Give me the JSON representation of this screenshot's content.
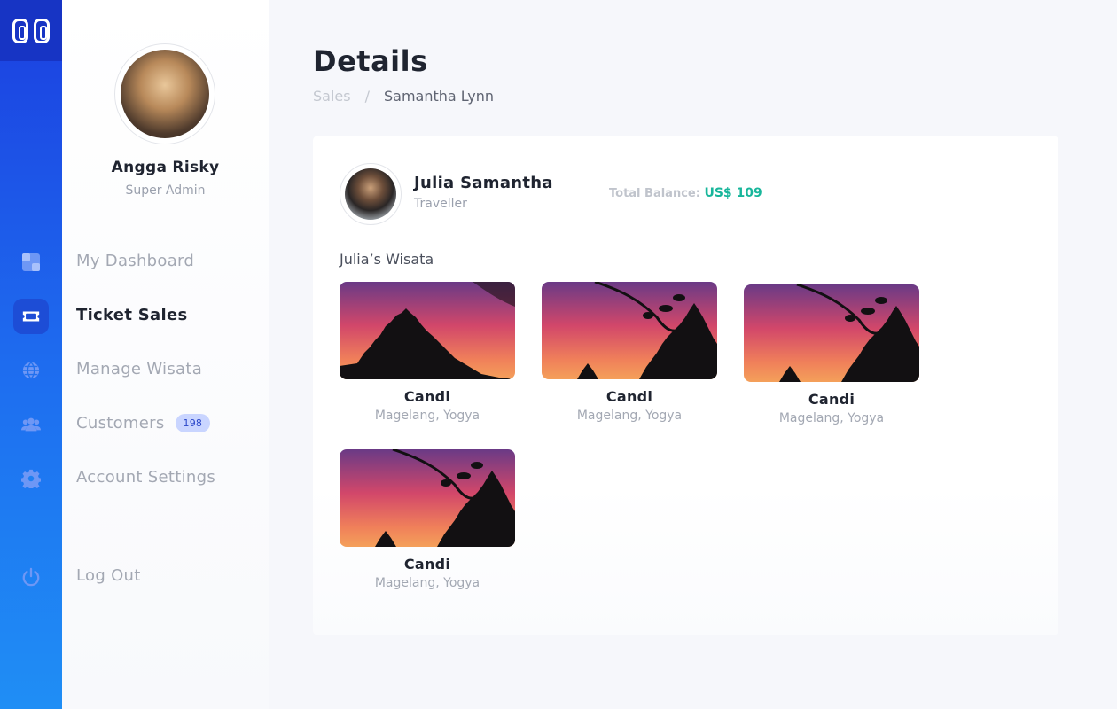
{
  "rail": {
    "icons": [
      "logo-icon",
      "dashboard-icon",
      "ticket-icon",
      "globe-icon",
      "users-icon",
      "gear-icon",
      "power-icon"
    ],
    "accent": "#1c3fe0"
  },
  "profile": {
    "name": "Angga Risky",
    "role": "Super Admin"
  },
  "menu": {
    "dashboard": "My Dashboard",
    "ticket_sales": "Ticket Sales",
    "manage_wisata": "Manage Wisata",
    "customers": "Customers",
    "customers_count": "198",
    "account_settings": "Account Settings",
    "logout": "Log Out"
  },
  "page": {
    "title": "Details",
    "breadcrumb": {
      "parent": "Sales",
      "separator": "/",
      "current": "Samantha Lynn"
    }
  },
  "customer": {
    "name": "Julia Samantha",
    "role": "Traveller",
    "balance_label": "Total Balance:",
    "balance_value": "US$ 109"
  },
  "wisata_section": {
    "title": "Julia’s Wisata",
    "items": [
      {
        "name": "Candi",
        "location": "Magelang, Yogya"
      },
      {
        "name": "Candi",
        "location": "Magelang, Yogya"
      },
      {
        "name": "Candi",
        "location": "Magelang, Yogya"
      },
      {
        "name": "Candi",
        "location": "Magelang, Yogya"
      }
    ]
  },
  "colors": {
    "balance": "#18b69b",
    "badge_bg": "#c9d5ff",
    "badge_text": "#2a46c9"
  }
}
